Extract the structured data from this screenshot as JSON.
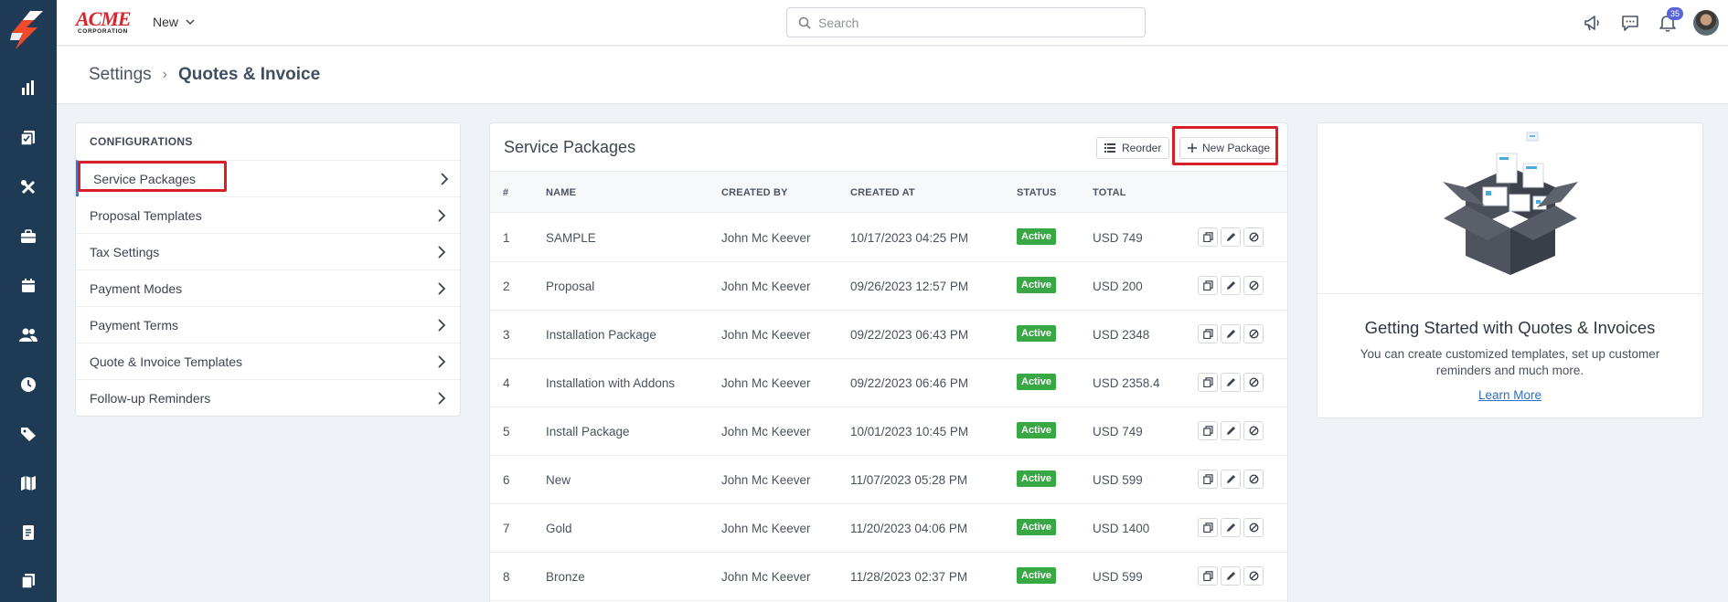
{
  "topbar": {
    "brand_name": "ACME",
    "brand_sub": "CORPORATION",
    "new_label": "New",
    "search_placeholder": "Search",
    "notification_count": "35"
  },
  "breadcrumb": {
    "parent": "Settings",
    "current": "Quotes & Invoice"
  },
  "config": {
    "title": "CONFIGURATIONS",
    "items": [
      "Service Packages",
      "Proposal Templates",
      "Tax Settings",
      "Payment Modes",
      "Payment Terms",
      "Quote & Invoice Templates",
      "Follow-up Reminders"
    ]
  },
  "packages": {
    "title": "Service Packages",
    "reorder_label": "Reorder",
    "new_label": "New Package",
    "columns": [
      "#",
      "NAME",
      "CREATED BY",
      "CREATED AT",
      "STATUS",
      "TOTAL"
    ],
    "rows": [
      {
        "num": "1",
        "name": "SAMPLE",
        "created_by": "John Mc Keever",
        "created_at": "10/17/2023 04:25 PM",
        "status": "Active",
        "total": "USD 749"
      },
      {
        "num": "2",
        "name": "Proposal",
        "created_by": "John Mc Keever",
        "created_at": "09/26/2023 12:57 PM",
        "status": "Active",
        "total": "USD 200"
      },
      {
        "num": "3",
        "name": "Installation Package",
        "created_by": "John Mc Keever",
        "created_at": "09/22/2023 06:43 PM",
        "status": "Active",
        "total": "USD 2348"
      },
      {
        "num": "4",
        "name": "Installation with Addons",
        "created_by": "John Mc Keever",
        "created_at": "09/22/2023 06:46 PM",
        "status": "Active",
        "total": "USD 2358.4"
      },
      {
        "num": "5",
        "name": "Install Package",
        "created_by": "John Mc Keever",
        "created_at": "10/01/2023 10:45 PM",
        "status": "Active",
        "total": "USD 749"
      },
      {
        "num": "6",
        "name": "New",
        "created_by": "John Mc Keever",
        "created_at": "11/07/2023 05:28 PM",
        "status": "Active",
        "total": "USD 599"
      },
      {
        "num": "7",
        "name": "Gold",
        "created_by": "John Mc Keever",
        "created_at": "11/20/2023 04:06 PM",
        "status": "Active",
        "total": "USD 1400"
      },
      {
        "num": "8",
        "name": "Bronze",
        "created_by": "John Mc Keever",
        "created_at": "11/28/2023 02:37 PM",
        "status": "Active",
        "total": "USD 599"
      }
    ]
  },
  "getting_started": {
    "title": "Getting Started with Quotes & Invoices",
    "description": "You can create customized templates, set up customer reminders and much more.",
    "link": "Learn More"
  },
  "colors": {
    "rail": "#1f3a55",
    "accent": "#3b7bd6",
    "active_status": "#38a845",
    "highlight": "#d8202a",
    "brand_red": "#d7262b"
  },
  "icons": {
    "rail": [
      "dashboard-icon",
      "estimates-icon",
      "tools-icon",
      "briefcase-icon",
      "calendar-icon",
      "users-icon",
      "clock-icon",
      "tag-icon",
      "map-icon",
      "invoice-icon",
      "documents-icon"
    ],
    "top": [
      "megaphone-icon",
      "chat-icon",
      "bell-icon"
    ],
    "row_actions": [
      "copy-icon",
      "edit-icon",
      "disable-icon"
    ]
  }
}
